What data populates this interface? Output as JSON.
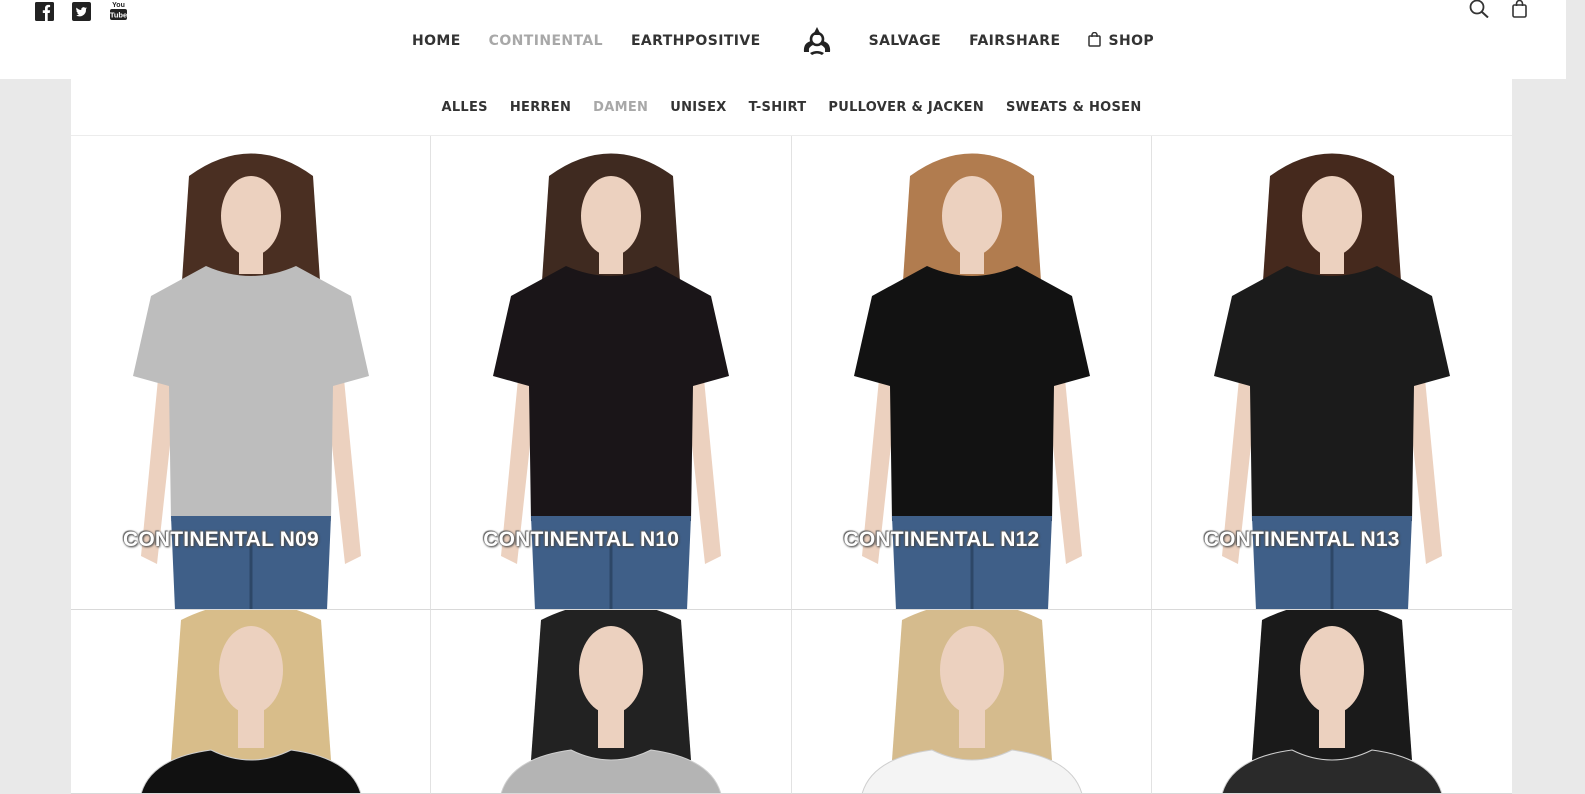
{
  "header": {
    "social": [
      {
        "name": "facebook-icon",
        "glyph": "f"
      },
      {
        "name": "twitter-icon",
        "glyph": "t"
      },
      {
        "name": "youtube-icon",
        "glyph": "You Tube"
      }
    ],
    "nav_left": [
      {
        "label": "HOME",
        "active": false
      },
      {
        "label": "CONTINENTAL",
        "active": true
      },
      {
        "label": "EARTHPOSITIVE",
        "active": false
      }
    ],
    "nav_right": [
      {
        "label": "SALVAGE",
        "active": false
      },
      {
        "label": "FAIRSHARE",
        "active": false
      },
      {
        "label": "SHOP",
        "active": false
      }
    ],
    "tools": [
      "search-icon",
      "cart-icon"
    ]
  },
  "filters": [
    {
      "label": "ALLES",
      "active": false
    },
    {
      "label": "HERREN",
      "active": false
    },
    {
      "label": "DAMEN",
      "active": true
    },
    {
      "label": "UNISEX",
      "active": false
    },
    {
      "label": "T-SHIRT",
      "active": false
    },
    {
      "label": "PULLOVER & JACKEN",
      "active": false
    },
    {
      "label": "SWEATS & HOSEN",
      "active": false
    }
  ],
  "products": [
    {
      "title": "CONTINENTAL N09",
      "shirt_color": "#bdbdbd",
      "hair_color": "#4a2f22",
      "jeans": true
    },
    {
      "title": "CONTINENTAL N10",
      "shirt_color": "#1a1518",
      "hair_color": "#3f2a20",
      "jeans": true
    },
    {
      "title": "CONTINENTAL N12",
      "shirt_color": "#121212",
      "hair_color": "#b17c4f",
      "jeans": true
    },
    {
      "title": "CONTINENTAL N13",
      "shirt_color": "#1b1b1b",
      "hair_color": "#45291d",
      "jeans": true
    },
    {
      "title": "",
      "shirt_color": "#111111",
      "hair_color": "#d8bd8a",
      "jeans": false
    },
    {
      "title": "",
      "shirt_color": "#b4b4b4",
      "hair_color": "#222222",
      "jeans": false
    },
    {
      "title": "",
      "shirt_color": "#f4f4f4",
      "hair_color": "#d5bb8d",
      "jeans": false
    },
    {
      "title": "",
      "shirt_color": "#2a2a2a",
      "hair_color": "#1a1a1a",
      "jeans": false
    }
  ],
  "colors": {
    "active_link": "#a8a8a8",
    "text": "#333333",
    "page_bg": "#e9e9e9"
  }
}
